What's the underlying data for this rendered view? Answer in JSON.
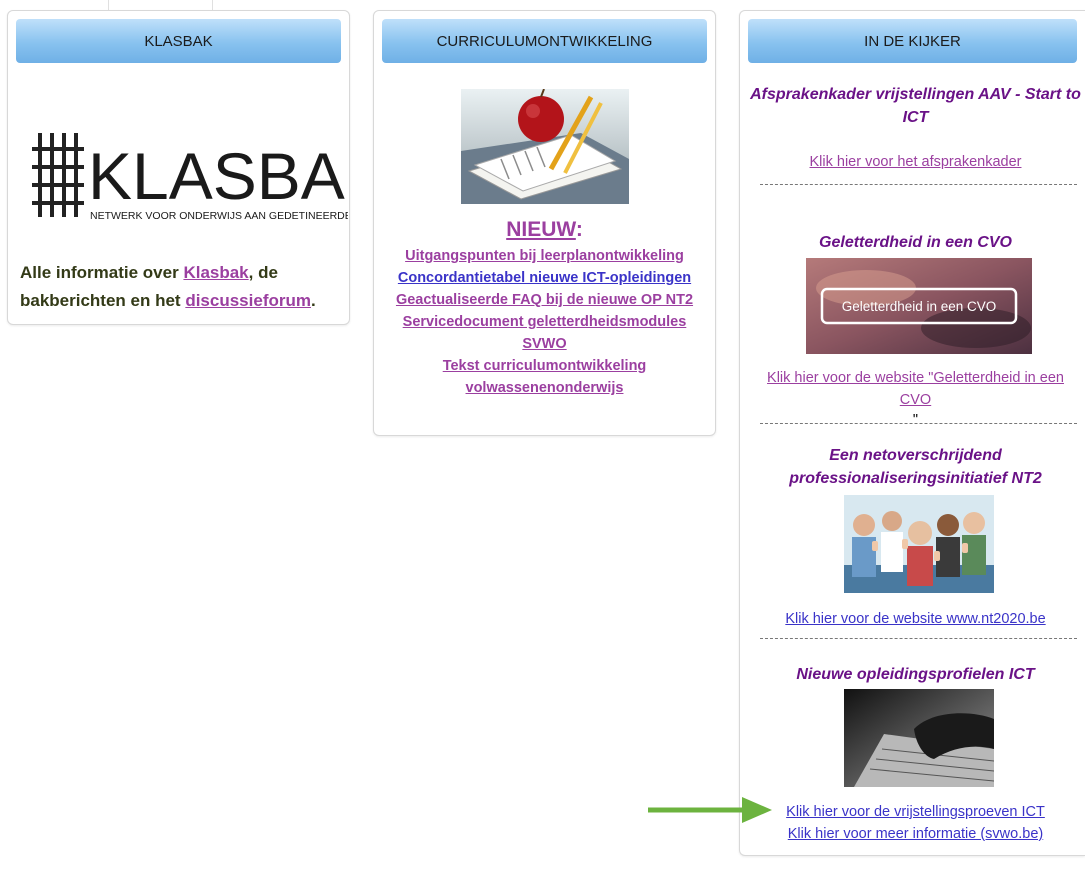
{
  "top_nav": [
    "",
    "",
    ""
  ],
  "panels": {
    "klasbak": {
      "header": "KLASBAK",
      "logo_text": "KLASBAK",
      "logo_subtitle": "NETWERK VOOR ONDERWIJS AAN GEDETINEERDEN",
      "text_prefix": "Alle informatie over ",
      "link1": "Klasbak",
      "text_mid": ", de bakberichten en het ",
      "link2": "discussieforum",
      "text_end": "."
    },
    "curriculum": {
      "header": "CURRICULUMONTWIKKELING",
      "nieuw": "NIEUW",
      "nieuw_colon": ":",
      "links": [
        "Uitgangspunten bij leerplanontwikkeling",
        "Concordantietabel nieuwe ICT-opleidingen",
        "Geactualiseerde FAQ bij de nieuwe OP NT2",
        "Servicedocument geletterdheidsmodules SVWO",
        "Tekst curriculumontwikkeling volwassenenonderwijs"
      ]
    },
    "kijker": {
      "header": "IN DE KIJKER",
      "item1_title": "Afsprakenkader vrijstellingen AAV - Start to ICT",
      "item1_link": "Klik hier voor het afsprakenkader",
      "item2_title": "Geletterdheid in een CVO",
      "item2_image_text": "Geletterdheid in een CVO",
      "item2_link_a": "Klik hier voor de website \"Geletterdheid in een ",
      "item2_link_b": "CVO",
      "item2_link_c": "\"",
      "item3_title": "Een netoverschrijdend professionaliseringsinitiatief NT2",
      "item3_link": "Klik hier voor de website www.nt2020.be",
      "item4_title": "Nieuwe opleidingsprofielen ICT",
      "item4_link1": "Klik hier voor de vrijstellingsproeven ICT",
      "item4_link2": "Klik hier voor meer informatie (svwo.be)"
    }
  },
  "colors": {
    "link_purple": "#9b3fa0",
    "link_blue": "#3a33c8",
    "title_purple": "#6a1287",
    "header_blue": "#88c2ef",
    "arrow_green": "#6cb33f"
  }
}
